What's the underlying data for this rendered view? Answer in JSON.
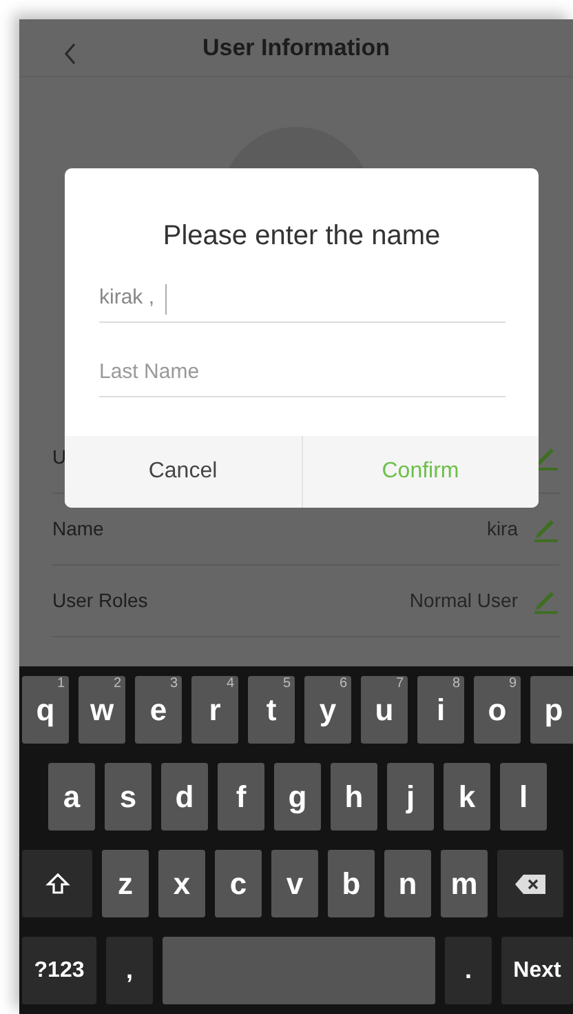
{
  "header": {
    "title": "User Information"
  },
  "rows": [
    {
      "label": "U",
      "editable": true
    },
    {
      "label": "Name",
      "value": "kira",
      "editable": true
    },
    {
      "label": "User Roles",
      "value": "Normal User",
      "editable": true
    }
  ],
  "dialog": {
    "title": "Please enter the name",
    "fields": [
      {
        "value": "kirak ,",
        "focused": true
      },
      {
        "placeholder": "Last Name",
        "focused": false
      }
    ],
    "buttons": [
      {
        "label": "Cancel",
        "kind": "cancel"
      },
      {
        "label": "Confirm",
        "kind": "confirm"
      }
    ]
  },
  "keyboard": {
    "key_rows": [
      {
        "indented": false,
        "keys": [
          {
            "kind": "char",
            "label": "q",
            "hint": "1"
          },
          {
            "kind": "char",
            "label": "w",
            "hint": "2"
          },
          {
            "kind": "char",
            "label": "e",
            "hint": "3"
          },
          {
            "kind": "char",
            "label": "r",
            "hint": "4"
          },
          {
            "kind": "char",
            "label": "t",
            "hint": "5"
          },
          {
            "kind": "char",
            "label": "y",
            "hint": "6"
          },
          {
            "kind": "char",
            "label": "u",
            "hint": "7"
          },
          {
            "kind": "char",
            "label": "i",
            "hint": "8"
          },
          {
            "kind": "char",
            "label": "o",
            "hint": "9"
          },
          {
            "kind": "char",
            "label": "p"
          }
        ]
      },
      {
        "indented": true,
        "keys": [
          {
            "kind": "char",
            "label": "a"
          },
          {
            "kind": "char",
            "label": "s"
          },
          {
            "kind": "char",
            "label": "d"
          },
          {
            "kind": "char",
            "label": "f"
          },
          {
            "kind": "char",
            "label": "g"
          },
          {
            "kind": "char",
            "label": "h"
          },
          {
            "kind": "char",
            "label": "j"
          },
          {
            "kind": "char",
            "label": "k"
          },
          {
            "kind": "char",
            "label": "l"
          }
        ]
      },
      {
        "indented": false,
        "keys": [
          {
            "kind": "shift"
          },
          {
            "kind": "char",
            "label": "z"
          },
          {
            "kind": "char",
            "label": "x"
          },
          {
            "kind": "char",
            "label": "c"
          },
          {
            "kind": "char",
            "label": "v"
          },
          {
            "kind": "char",
            "label": "b"
          },
          {
            "kind": "char",
            "label": "n"
          },
          {
            "kind": "char",
            "label": "m"
          },
          {
            "kind": "backspace"
          }
        ]
      },
      {
        "indented": false,
        "keys": [
          {
            "kind": "symbols",
            "label": "?123"
          },
          {
            "kind": "punct",
            "label": ","
          },
          {
            "kind": "space"
          },
          {
            "kind": "punct",
            "label": "."
          },
          {
            "kind": "action",
            "label": "Next"
          }
        ]
      }
    ]
  }
}
